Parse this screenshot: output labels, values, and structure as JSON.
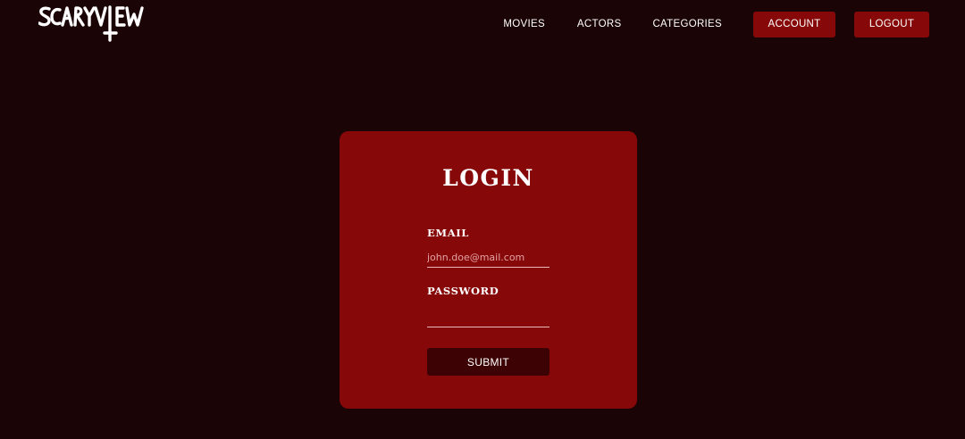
{
  "brand": {
    "logo_text": "SCARYVIEW"
  },
  "nav": {
    "movies": "MOVIES",
    "actors": "ACTORS",
    "categories": "CATEGORIES",
    "account": "ACCOUNT",
    "logout": "LOGOUT"
  },
  "login": {
    "title": "LOGIN",
    "email_label": "EMAIL",
    "email_value": "",
    "email_placeholder": "john.doe@mail.com",
    "password_label": "PASSWORD",
    "password_value": "",
    "password_placeholder": "",
    "submit_label": "SUBMIT"
  },
  "colors": {
    "background": "#1a0405",
    "accent": "#870809",
    "submit_bg": "#3d0204"
  }
}
